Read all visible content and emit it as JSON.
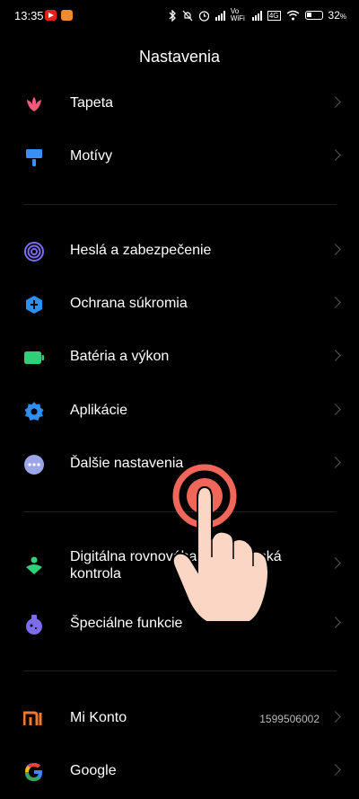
{
  "status_bar": {
    "time": "13:35",
    "network_label": "Vo WiFi",
    "lte_label": "4G",
    "battery_percent": "32"
  },
  "header": {
    "title": "Nastavenia"
  },
  "settings": {
    "wallpaper": {
      "label": "Tapeta",
      "icon": "flower-icon",
      "color": "#ef5b7a"
    },
    "themes": {
      "label": "Motívy",
      "icon": "brush-icon",
      "color": "#3a8ff5"
    },
    "passwords": {
      "label": "Heslá a zabezpečenie",
      "icon": "fingerprint-icon",
      "color": "#7b6cf0"
    },
    "privacy": {
      "label": "Ochrana súkromia",
      "icon": "shield-icon",
      "color": "#2d8ff0"
    },
    "battery": {
      "label": "Batéria a výkon",
      "icon": "battery-icon",
      "color": "#2fd07a"
    },
    "apps": {
      "label": "Aplikácie",
      "icon": "gear-icon",
      "color": "#2d8ff0"
    },
    "more": {
      "label": "Ďalšie nastavenia",
      "icon": "more-dots-icon",
      "color": "#9aa6e8"
    },
    "wellbeing": {
      "label": "Digitálna rovnováha a rodičovská kontrola",
      "icon": "wellbeing-icon",
      "color": "#2fd07a"
    },
    "special": {
      "label": "Špeciálne funkcie",
      "icon": "potion-icon",
      "color": "#7b6cf0"
    },
    "mi_account": {
      "label": "Mi Konto",
      "value": "1599506002",
      "icon": "mi-logo-icon",
      "color": "#f07a2b"
    },
    "google": {
      "label": "Google",
      "icon": "google-icon"
    }
  }
}
